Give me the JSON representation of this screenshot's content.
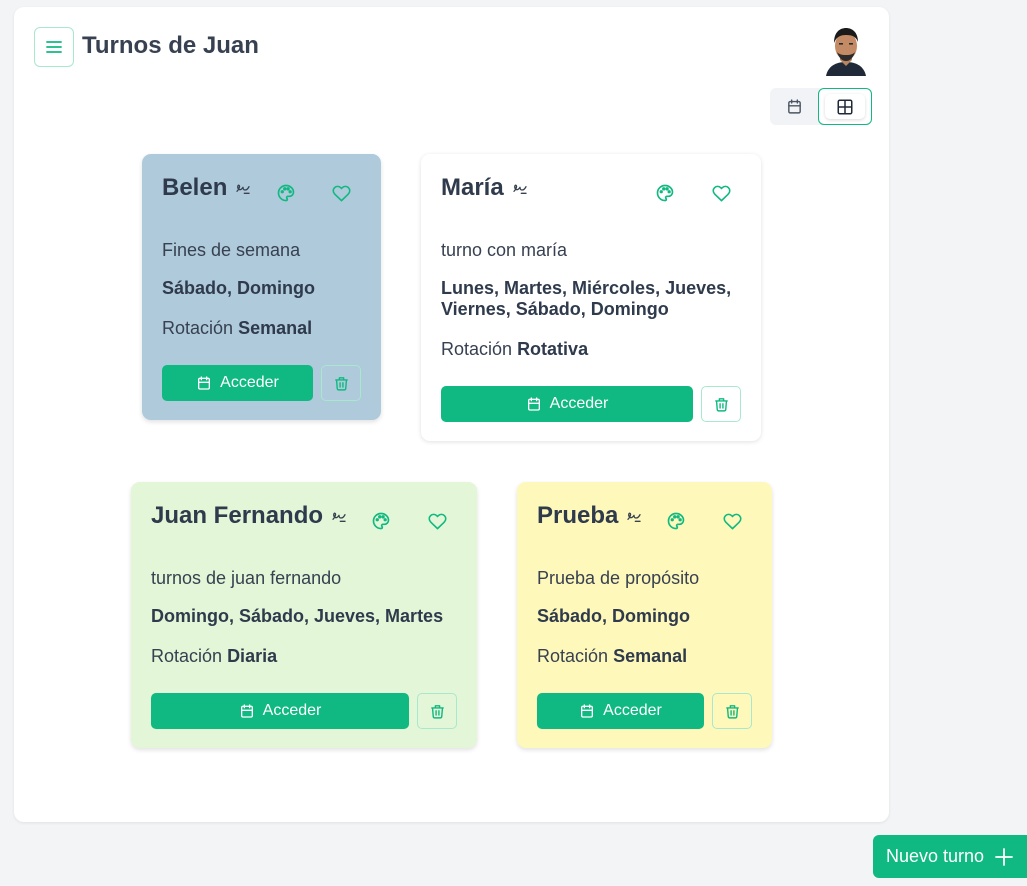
{
  "header": {
    "title": "Turnos de Juan",
    "menu_icon": "hamburger-menu-icon",
    "avatar_icon": "user-avatar"
  },
  "view_toggle": {
    "options": [
      "calendar-view",
      "grid-view"
    ],
    "selected": "grid-view"
  },
  "colors": {
    "accent": "#10b981",
    "card_blue": "#afcadb",
    "card_white": "#ffffff",
    "card_green": "#e3f6d7",
    "card_yellow": "#fef8ba"
  },
  "cards": [
    {
      "name": "Belen",
      "description": "Fines de semana",
      "days": "Sábado, Domingo",
      "rotation_label": "Rotación",
      "rotation_value": "Semanal",
      "access_label": "Acceder",
      "color": "blue"
    },
    {
      "name": "María",
      "description": "turno con maría",
      "days": "Lunes, Martes, Miércoles, Jueves, Viernes, Sábado, Domingo",
      "rotation_label": "Rotación",
      "rotation_value": "Rotativa",
      "access_label": "Acceder",
      "color": "white"
    },
    {
      "name": "Juan Fernando",
      "description": "turnos de juan fernando",
      "days": "Domingo, Sábado, Jueves, Martes",
      "rotation_label": "Rotación",
      "rotation_value": "Diaria",
      "access_label": "Acceder",
      "color": "green"
    },
    {
      "name": "Prueba",
      "description": "Prueba de propósito",
      "days": "Sábado, Domingo",
      "rotation_label": "Rotación",
      "rotation_value": "Semanal",
      "access_label": "Acceder",
      "color": "yellow"
    }
  ],
  "new_button": {
    "label": "Nuevo turno"
  }
}
